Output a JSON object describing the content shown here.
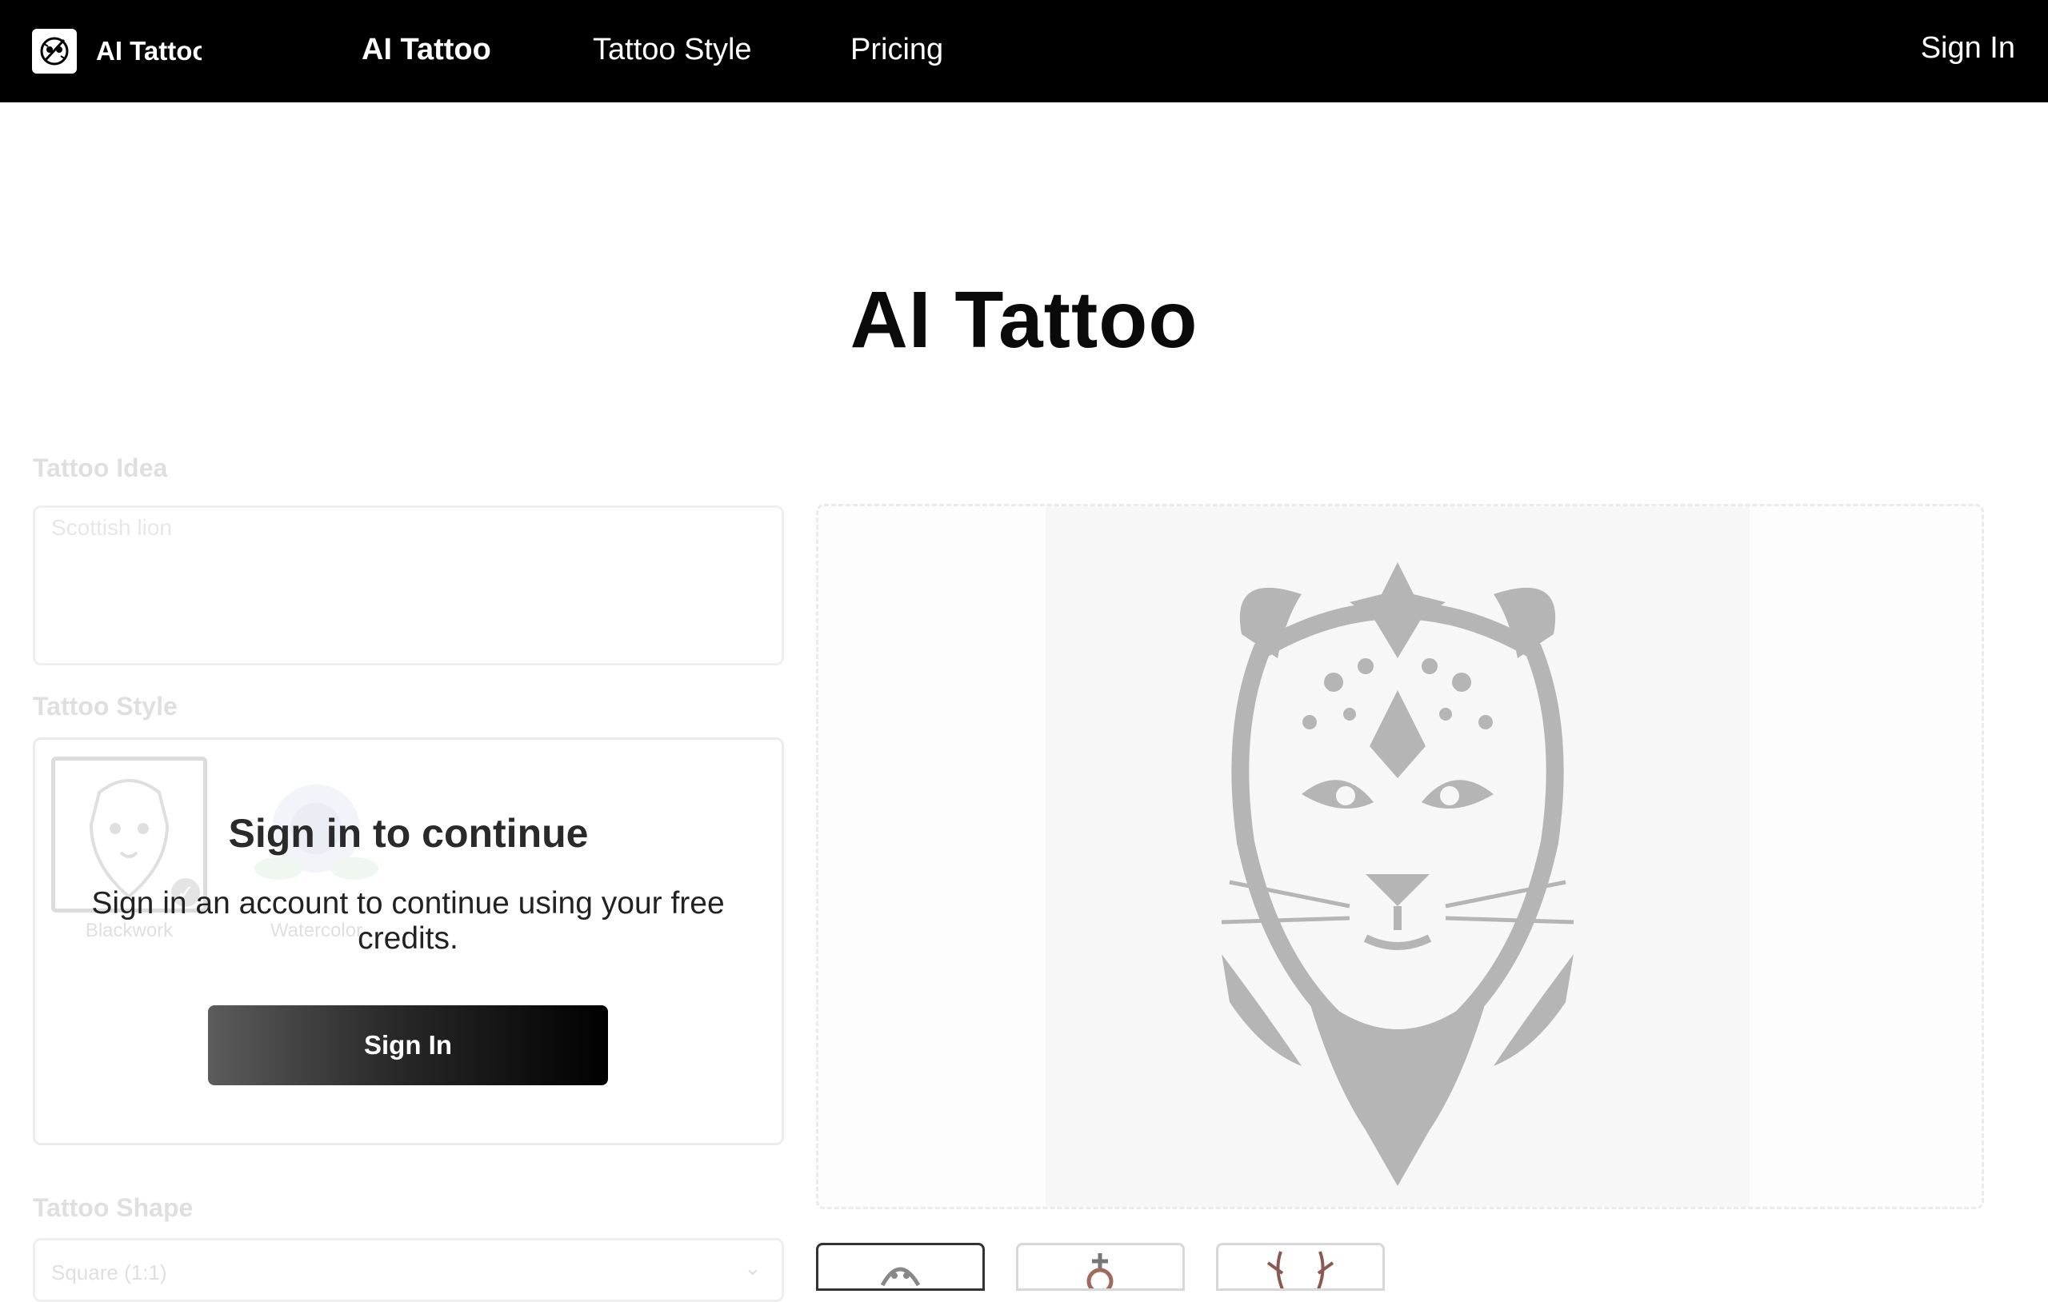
{
  "nav": {
    "logo_text": "AI Tattoo",
    "links": [
      {
        "label": "AI Tattoo",
        "active": true
      },
      {
        "label": "Tattoo Style",
        "active": false
      },
      {
        "label": "Pricing",
        "active": false
      }
    ],
    "signin": "Sign In"
  },
  "page": {
    "title": "AI Tattoo"
  },
  "form": {
    "idea_label": "Tattoo Idea",
    "idea_placeholder": "Scottish lion",
    "style_label": "Tattoo Style",
    "styles": [
      {
        "label": "Blackwork",
        "selected": true
      },
      {
        "label": "Watercolor",
        "selected": false
      }
    ],
    "shape_label": "Tattoo Shape",
    "shape_value": "Square (1:1)"
  },
  "overlay": {
    "title": "Sign in to continue",
    "text": "Sign in an account to continue using your free credits.",
    "button": "Sign In"
  },
  "icons": {
    "logo": "tattoo-machine-logo-icon",
    "check": "check-icon",
    "chevron": "chevron-down-icon"
  },
  "colors": {
    "nav_bg": "#000000",
    "button_gradient_start": "#5c5c5c",
    "button_gradient_end": "#000000"
  }
}
